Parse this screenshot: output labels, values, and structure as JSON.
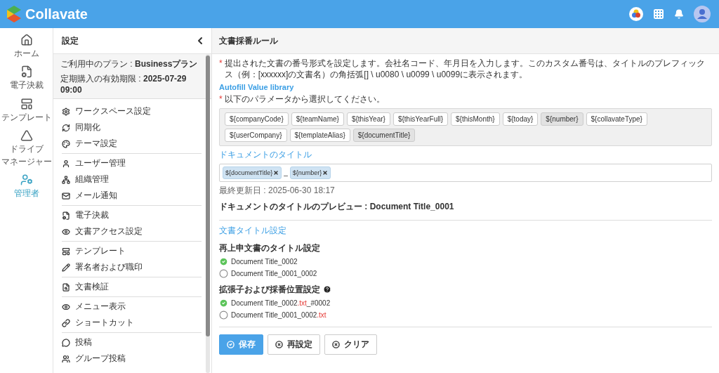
{
  "header": {
    "brand": "Collavate"
  },
  "rail": [
    {
      "lines": [
        "ホーム"
      ],
      "selected": false
    },
    {
      "lines": [
        "電子決裁"
      ],
      "selected": false
    },
    {
      "lines": [
        "テンプレート"
      ],
      "selected": false
    },
    {
      "lines": [
        "ドライブ",
        "マネージャー"
      ],
      "selected": false
    },
    {
      "lines": [
        "管理者"
      ],
      "selected": true
    }
  ],
  "sidebar": {
    "title": "設定",
    "plan": {
      "label": "ご利用中のプラン : ",
      "value": "Businessプラン"
    },
    "expiry": {
      "label": "定期購入の有効期限 : ",
      "value": "2025-07-29 09:00"
    },
    "groups": [
      [
        "ワークスペース設定",
        "同期化",
        "テーマ設定"
      ],
      [
        "ユーザー管理",
        "組織管理",
        "メール通知"
      ],
      [
        "電子決裁",
        "文書アクセス設定"
      ],
      [
        "テンプレート",
        "署名者および職印"
      ],
      [
        "文書検証"
      ],
      [
        "メニュー表示",
        "ショートカット"
      ],
      [
        "投稿",
        "グループ投稿"
      ]
    ]
  },
  "page": {
    "title": "文書採番ルール",
    "required_mark": "*",
    "notice": "提出された文書の番号形式を設定します。会社名コード、年月日を入力します。このカスタム番号は、タイトルのプレフィックス（例：[xxxxxx]の文書名）の角括弧[] \\ u0080 \\ u0099 \\ u0099に表示されます。",
    "library_title": "Autofill Value library",
    "library_hint": "以下のパラメータから選択してください。",
    "parameters": [
      {
        "label": "${companyCode}",
        "selected": false
      },
      {
        "label": "${teamName}",
        "selected": false
      },
      {
        "label": "${thisYear}",
        "selected": false
      },
      {
        "label": "${thisYearFull}",
        "selected": false
      },
      {
        "label": "${thisMonth}",
        "selected": false
      },
      {
        "label": "${today}",
        "selected": false
      },
      {
        "label": "${number}",
        "selected": true
      },
      {
        "label": "${collavateType}",
        "selected": false
      },
      {
        "label": "${userCompany}",
        "selected": false
      },
      {
        "label": "${templateAlias}",
        "selected": false
      },
      {
        "label": "${documentTitle}",
        "selected": true
      }
    ],
    "doc_title_label": "ドキュメントのタイトル",
    "tokens": [
      {
        "label": "${documentTitle}"
      },
      {
        "label": "${number}"
      }
    ],
    "separator": "_",
    "updated": "最終更新日 : 2025-06-30 18:17",
    "preview": "ドキュメントのタイトルのプレビュー : Document Title_0001",
    "settings_title": "文書タイトル設定",
    "groups": [
      {
        "title": "再上申文書のタイトル設定",
        "help": false,
        "options": [
          {
            "base": "Document Title_0002",
            "selected": true
          },
          {
            "base": "Document Title_0001_0002",
            "selected": false
          }
        ]
      },
      {
        "title": "拡張子および採番位置設定",
        "help": true,
        "options": [
          {
            "base": "Document Title_0002",
            "ext": ".txt",
            "suffix": "_#0002",
            "selected": true
          },
          {
            "base": "Document Title_0001_0002",
            "ext": ".txt",
            "selected": false
          }
        ]
      }
    ],
    "buttons": [
      {
        "label": "保存",
        "kind": "primary"
      },
      {
        "label": "再設定",
        "kind": "default"
      },
      {
        "label": "クリア",
        "kind": "default"
      }
    ]
  }
}
